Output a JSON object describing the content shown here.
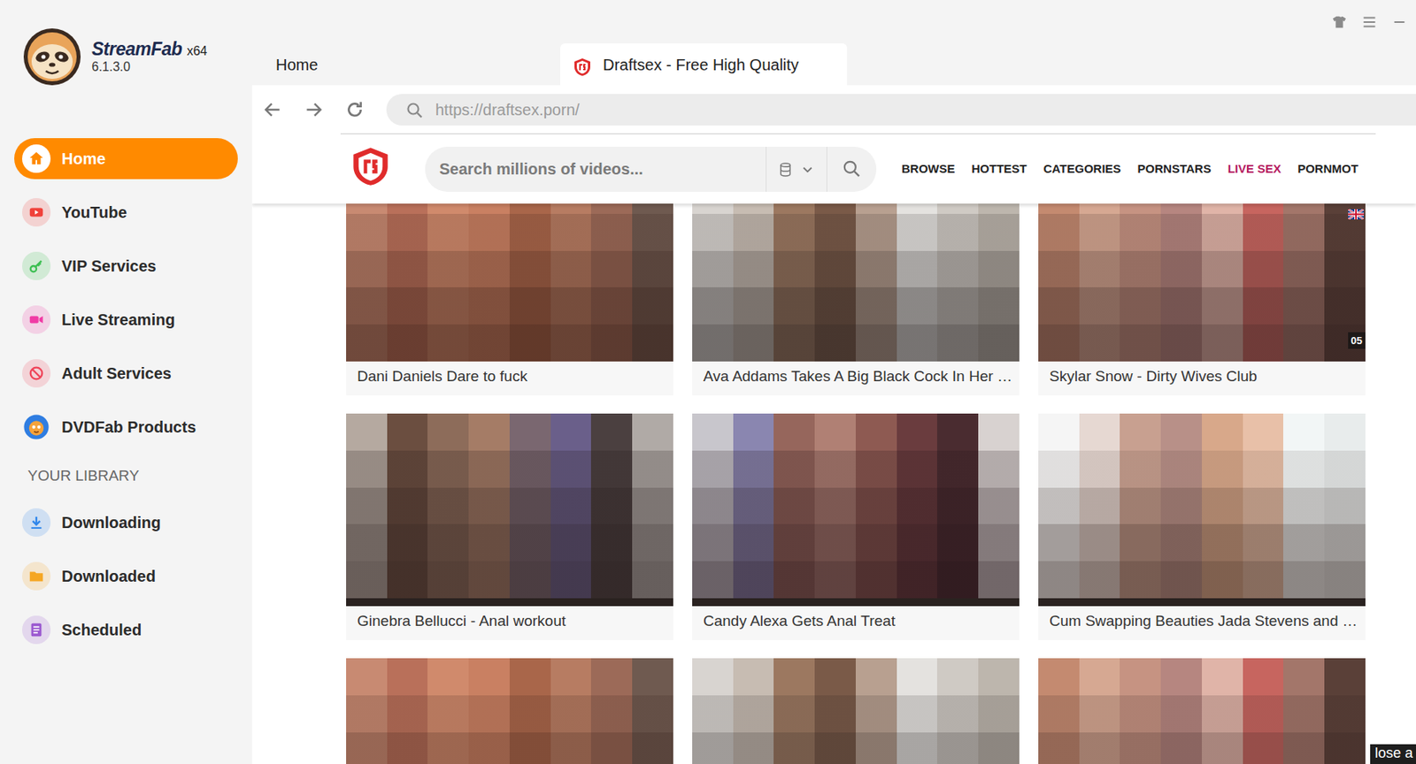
{
  "app": {
    "name": "StreamFab",
    "arch": "x64",
    "version": "6.1.3.0"
  },
  "sidebar": {
    "items": [
      {
        "label": "Home",
        "selected": true,
        "color": "#ff8a00"
      },
      {
        "label": "YouTube",
        "selected": false,
        "color": "#f0413a"
      },
      {
        "label": "VIP Services",
        "selected": false,
        "color": "#3cbf52"
      },
      {
        "label": "Live Streaming",
        "selected": false,
        "color": "#f03ca5"
      },
      {
        "label": "Adult Services",
        "selected": false,
        "color": "#ef4458"
      },
      {
        "label": "DVDFab Products",
        "selected": false,
        "color": "#2f7de1"
      }
    ]
  },
  "library": {
    "heading": "YOUR LIBRARY",
    "items": [
      {
        "label": "Downloading",
        "selected": false,
        "color": "#2f86eb"
      },
      {
        "label": "Downloaded",
        "selected": false,
        "color": "#f5a623"
      },
      {
        "label": "Scheduled",
        "selected": false,
        "color": "#9b59d0"
      }
    ]
  },
  "tabs": [
    {
      "label": "Home",
      "selected": false
    },
    {
      "label": "Draftsex - Free High Quality",
      "selected": true
    }
  ],
  "address": {
    "url": "https://draftsex.porn/"
  },
  "site": {
    "search": {
      "placeholder": "Search millions of videos..."
    },
    "nav": [
      {
        "label": "BROWSE",
        "color": "#222222"
      },
      {
        "label": "HOTTEST",
        "color": "#222222"
      },
      {
        "label": "CATEGORIES",
        "color": "#222222"
      },
      {
        "label": "PORNSTARS",
        "color": "#222222"
      },
      {
        "label": "LIVE SEX",
        "color": "#b5195f"
      },
      {
        "label": "PORNMOT",
        "color": "#222222"
      }
    ]
  },
  "videos": [
    {
      "title": "Dani Daniels Dare to fuck",
      "cut": false
    },
    {
      "title": "Ava Addams Takes A Big Black Cock In Her …",
      "cut": false
    },
    {
      "title": "Skylar Snow - Dirty Wives Club",
      "badge": "05",
      "cut": false
    },
    {
      "title": "Ginebra Bellucci - Anal workout",
      "cut": false
    },
    {
      "title": "Candy Alexa Gets Anal Treat",
      "cut": false
    },
    {
      "title": "Cum Swapping Beauties Jada Stevens and …",
      "cut": false
    },
    {
      "cut": true
    },
    {
      "cut": true
    },
    {
      "cut": true
    }
  ],
  "ad_close": "lose a"
}
